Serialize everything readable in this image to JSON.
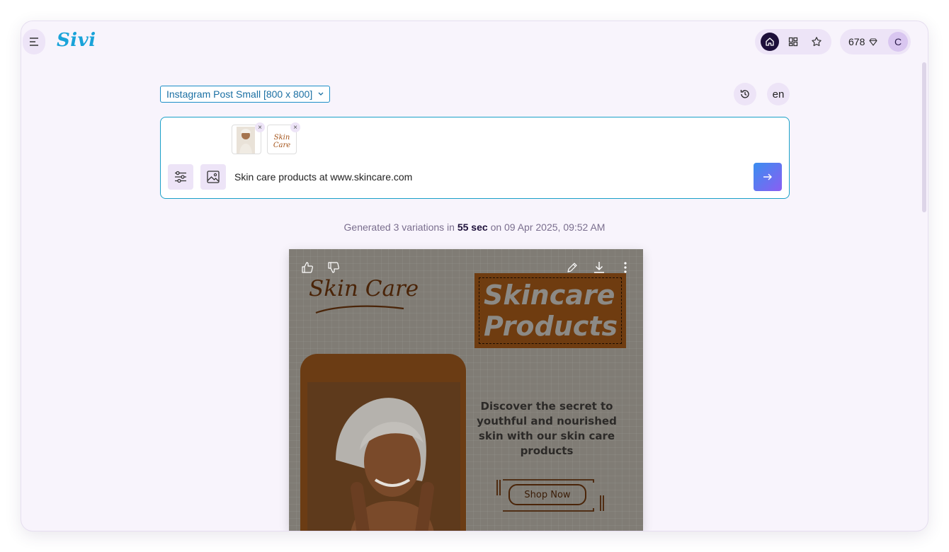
{
  "app": {
    "logo": "Sivi"
  },
  "nav": {
    "home_icon": "home-icon",
    "grid_icon": "grid-icon",
    "star_icon": "star-icon"
  },
  "credits": {
    "count": "678",
    "icon": "diamond-icon"
  },
  "user": {
    "avatar_initial": "C"
  },
  "toolbar": {
    "size_select": "Instagram Post Small [800 x 800]",
    "language": "en"
  },
  "prompt": {
    "text": "Skin care products at www.skincare.com",
    "attachments": [
      {
        "type": "photo",
        "remove": "×"
      },
      {
        "type": "logo",
        "label": "Skin Care",
        "remove": "×"
      }
    ]
  },
  "generation": {
    "prefix": "Generated 3 variations in",
    "duration": "55 sec",
    "suffix": "on 09 Apr 2025, 09:52 AM"
  },
  "design": {
    "brand_logo": "Skin Care",
    "headline_line1": "Skincare",
    "headline_line2": "Products",
    "description": "Discover the secret to youthful and nourished skin with our skin care products",
    "cta": "Shop Now"
  },
  "colors": {
    "accent": "#1aa3d9",
    "nav_active": "#1d0f3a",
    "poster_brown": "#6f3c10"
  }
}
